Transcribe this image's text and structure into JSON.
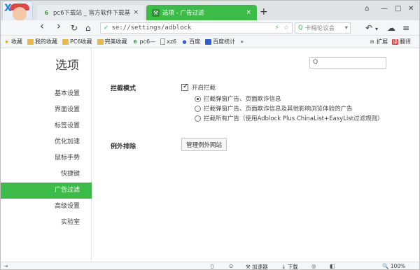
{
  "tabs": [
    {
      "favicon": "6",
      "title": "pc6下载站 _ 官方软件下载基地_",
      "close": "×"
    },
    {
      "favicon": "⚒",
      "title": "选项 - 广告过滤",
      "close": "×"
    }
  ],
  "new_tab": "+",
  "window_controls": [
    "⌂",
    "—",
    "□",
    "✕"
  ],
  "nav": {
    "back": "‹",
    "forward": "›",
    "reload": "↻",
    "home": "⌂",
    "shield": "✓"
  },
  "address": {
    "url": "se://settings/adblock",
    "lightning": "⚡",
    "star": "☆"
  },
  "search": {
    "placeholder": "卡梅伦议会",
    "icon": "Q",
    "arrow": "▾"
  },
  "toolbar_right": [
    "↶",
    "▾",
    "☁",
    "≡"
  ],
  "bookmarks": [
    {
      "icon": "star",
      "label": "收藏"
    },
    {
      "icon": "folder",
      "label": "我的收藏"
    },
    {
      "icon": "folder",
      "label": "PC6收藏"
    },
    {
      "icon": "folder",
      "label": "完美收藏"
    },
    {
      "icon": "6",
      "label": "pc6—"
    },
    {
      "icon": "page",
      "label": "xz6"
    },
    {
      "icon": "paw",
      "label": "百度"
    },
    {
      "icon": "blue",
      "label": "百度统计"
    }
  ],
  "bookmarks_more": "»",
  "bookmarks_right": [
    {
      "icon": "grid",
      "label": "扩展"
    },
    {
      "icon": "red",
      "label": "翻译"
    }
  ],
  "settings": {
    "title": "选项",
    "search_icon": "Q",
    "nav_items": [
      "基本设置",
      "界面设置",
      "标签设置",
      "优化加速",
      "鼠标手势",
      "快捷键",
      "广告过滤",
      "高级设置",
      "实验室"
    ],
    "active_index": 6,
    "adblock": {
      "label": "拦截模式",
      "enable_label": "开启拦截",
      "enabled": true,
      "options": [
        "拦截弹窗广告、页面欺诈信息",
        "拦截弹窗广告、页面欺诈信息及其他影响浏览体验的广告",
        "拦截所有广告（使用Adblock Plus ChinaList+EasyList过滤规则）"
      ],
      "selected_option": 0
    },
    "exceptions": {
      "label": "例外排除",
      "button": "管理例外网站"
    }
  },
  "statusbar": {
    "left_icon": "⇥",
    "items": [
      "▯",
      "⊙",
      "⚒ 加速器",
      "↓ 下载",
      "◎",
      "◧",
      "🔍 100%"
    ]
  }
}
